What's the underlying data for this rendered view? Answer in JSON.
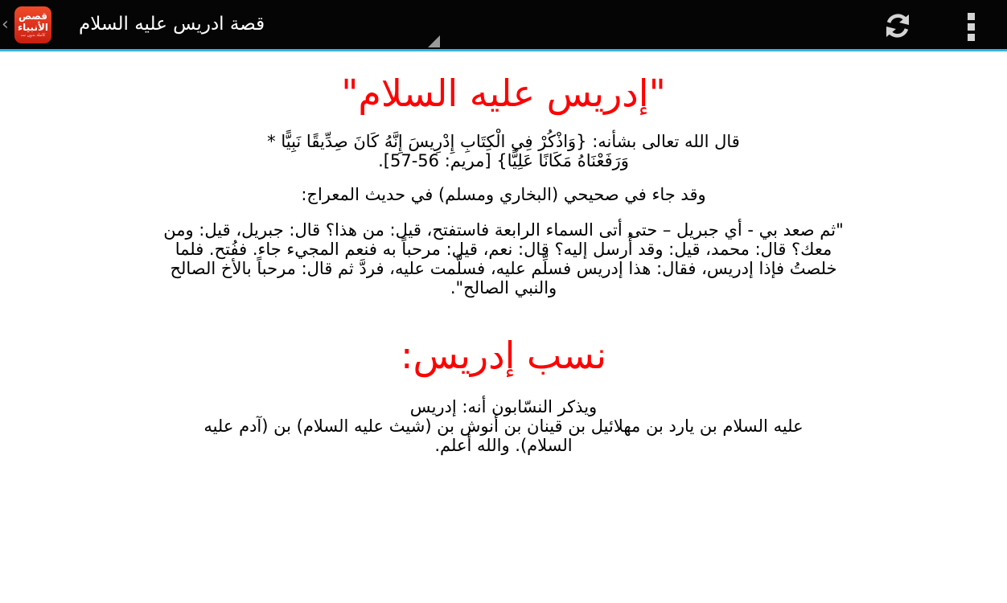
{
  "actionbar": {
    "app_icon_line1": "قصص",
    "app_icon_line2": "الأنبياء",
    "app_icon_line3": "كاملة بدون نت",
    "title": "قصة ادريس عليه السلام",
    "up_glyph": "‹",
    "icons": [
      "chevron-left-icon",
      "app-logo-icon",
      "spinner-triangle-icon",
      "refresh-icon",
      "overflow-menu-icon"
    ],
    "accent_color": "#33b5e5"
  },
  "article": {
    "heading": "\"إدريس عليه السلام\"",
    "quran_quote": "قال الله تعالى بشأنه: {وَاذْكُرْ فِي الْكِتَابِ إِدْرِيسَ إِنَّهُ كَانَ صِدِّيقًا نَبِيًّا * وَرَفَعْنَاهُ مَكَانًا عَلِيًّا} [مريم: 56-57].",
    "intro": "وقد جاء في صحيحي (البخاري ومسلم) في حديث المعراج:",
    "hadith": "\"ثم صعد بي - أي جبريل – حتى أتى السماء الرابعة فاستفتح، قيل: من هذا؟ قال: جبريل، قيل: ومن معك؟ قال: محمد، قيل: وقد أُرسل إليه؟ قال: نعم، قيل: مرحباً به فنعم المجيء جاء. ففُتح. فلما خلصتُ فإذا إدريس، فقال: هذا إدريس فسلِّم عليه، فسلَّمت عليه، فردَّ ثم قال: مرحباً بالأخ الصالح والنبي الصالح\".",
    "subheading": "نسب إدريس:",
    "lineage_line1": "ويذكر النسّابون أنه: إدريس",
    "lineage_rest": "عليه السلام بن يارد بن مهلائيل بن قينان بن أنوش بن (شيث عليه السلام) بن (آدم عليه السلام). والله أعلم.",
    "heading_color": "#ff0000"
  }
}
